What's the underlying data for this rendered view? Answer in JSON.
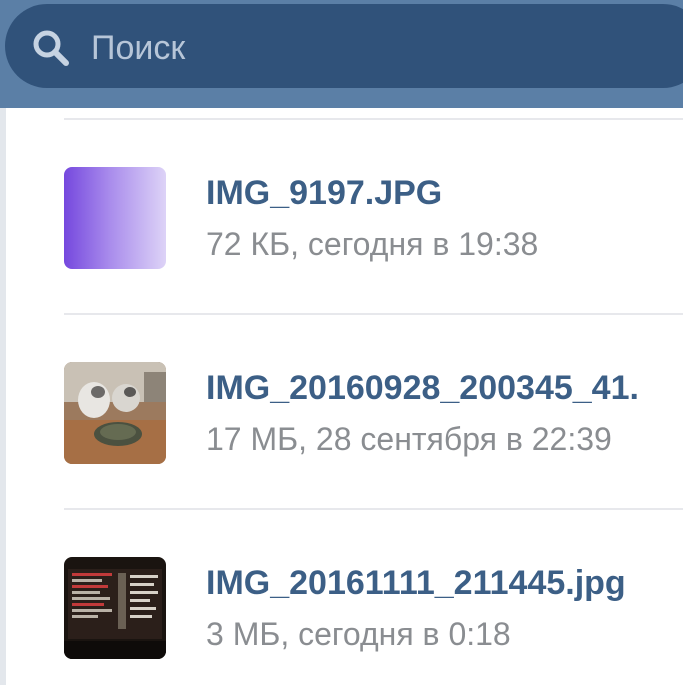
{
  "search": {
    "placeholder": "Поиск"
  },
  "files": [
    {
      "name": "IMG_9197.JPG",
      "meta": "72 КБ, сегодня в 19:38",
      "thumb": "purple-gradient"
    },
    {
      "name": "IMG_20160928_200345_41.",
      "meta": "17 МБ, 28 сентября в 22:39",
      "thumb": "cats-photo"
    },
    {
      "name": "IMG_20161111_211445.jpg",
      "meta": "3 МБ, сегодня в 0:18",
      "thumb": "screen-photo"
    }
  ],
  "colors": {
    "header": "#5b7fa6",
    "search_bg": "#30527a",
    "title": "#3c5f86",
    "meta": "#8a8d91"
  }
}
